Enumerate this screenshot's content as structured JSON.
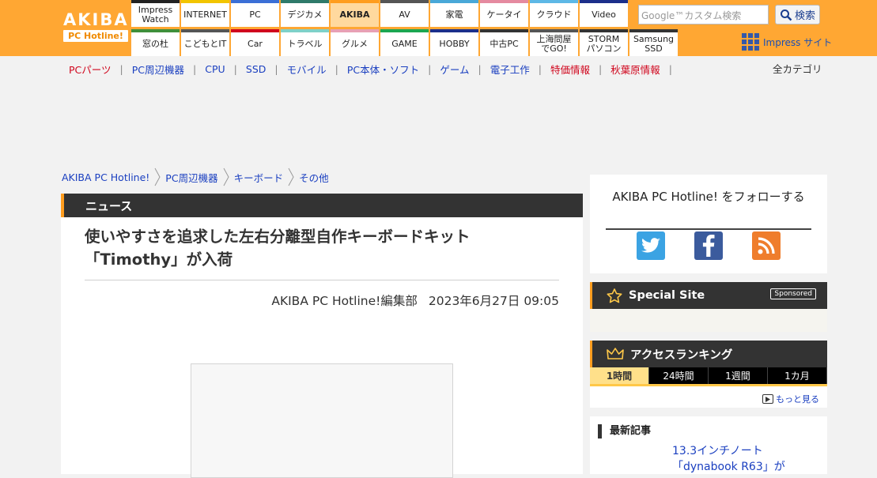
{
  "header": {
    "logo_line1": "AKIBA",
    "logo_line2": "PC Hotline!",
    "nav_row1": [
      {
        "label": "Impress\nWatch",
        "color": "#222222"
      },
      {
        "label": "INTERNET",
        "color": "#f2c500"
      },
      {
        "label": "PC",
        "color": "#3b6fd6"
      },
      {
        "label": "デジカメ",
        "color": "#2f7a6a"
      },
      {
        "label": "AKIBA",
        "color": "#ff9d1e",
        "active": true
      },
      {
        "label": "AV",
        "color": "#555555"
      },
      {
        "label": "家電",
        "color": "#49a8d8"
      },
      {
        "label": "ケータイ",
        "color": "#e58aa0"
      },
      {
        "label": "クラウド",
        "color": "#5db8e6"
      },
      {
        "label": "Video",
        "color": "#1c2f8a"
      }
    ],
    "nav_row2": [
      {
        "label": "窓の杜",
        "color": "#3f8f3a"
      },
      {
        "label": "こどもとIT",
        "color": "#555555"
      },
      {
        "label": "Car",
        "color": "#d0061d"
      },
      {
        "label": "トラベル",
        "color": "#7fd1c8"
      },
      {
        "label": "グルメ",
        "color": "#e8a0b4"
      },
      {
        "label": "GAME",
        "color": "#1ca650"
      },
      {
        "label": "HOBBY",
        "color": "#1c2f8a"
      },
      {
        "label": "中古PC",
        "color": "#333333"
      },
      {
        "label": "上海問屋\nでGO!",
        "color": "#555555"
      },
      {
        "label": "STORM\nパソコン",
        "color": "#333333"
      },
      {
        "label": "Samsung\nSSD",
        "color": "#333333"
      }
    ],
    "search_placeholder": "Google™カスタム検索",
    "search_button": "検索",
    "impress_site": "Impress サイト"
  },
  "categories": [
    {
      "label": "PCパーツ",
      "red": true
    },
    {
      "label": "PC周辺機器",
      "red": false
    },
    {
      "label": "CPU",
      "red": false
    },
    {
      "label": "SSD",
      "red": false
    },
    {
      "label": "モバイル",
      "red": false
    },
    {
      "label": "PC本体・ソフト",
      "red": false
    },
    {
      "label": "ゲーム",
      "red": false
    },
    {
      "label": "電子工作",
      "red": false
    },
    {
      "label": "特価情報",
      "red": true
    },
    {
      "label": "秋葉原情報",
      "red": true
    }
  ],
  "all_categories": "全カテゴリ",
  "breadcrumb": [
    "AKIBA PC Hotline!",
    "PC周辺機器",
    "キーボード",
    "その他"
  ],
  "article": {
    "section": "ニュース",
    "title_line1": "使いやすさを追求した左右分離型自作キーボードキット",
    "title_line2": "「Timothy」が入荷",
    "author": "AKIBA PC Hotline!編集部",
    "date": "2023年6月27日 09:05"
  },
  "sidebar": {
    "follow_title": "AKIBA PC Hotline! をフォローする",
    "social_icons": [
      "twitter-icon",
      "facebook-icon",
      "rss-icon"
    ],
    "special_site": "Special Site",
    "sponsored": "Sponsored",
    "ranking_title": "アクセスランキング",
    "ranking_tabs": [
      "1時間",
      "24時間",
      "1週間",
      "1カ月"
    ],
    "ranking_active": 0,
    "more": "もっと見る",
    "latest_title": "最新記事",
    "latest_item": "13.3インチノート「dynabook R63」が"
  }
}
